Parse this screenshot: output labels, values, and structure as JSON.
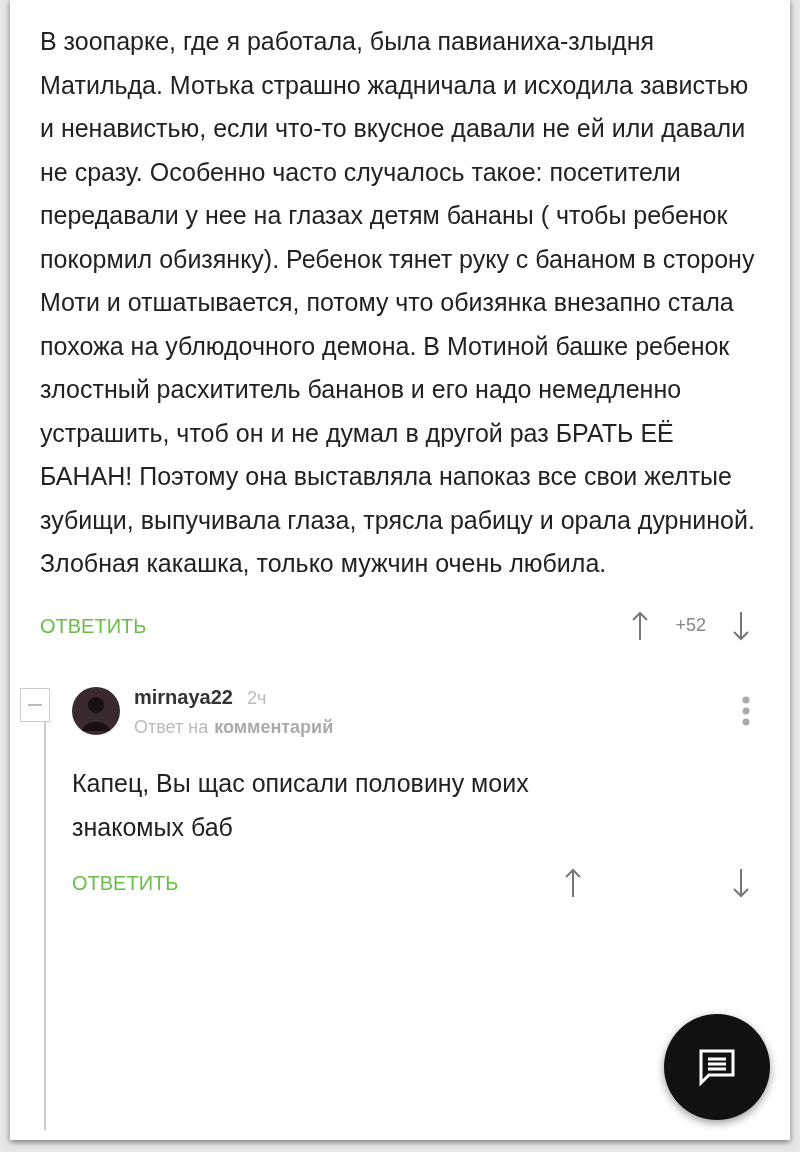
{
  "comment": {
    "text": "В зоопарке, где я работала, была павианиха-злыдня Матильда. Мотька страшно жадничала и исходила завистью и ненавистью, если что-то вкусное давали не ей или давали не сразу. Особенно часто случалось такое: посетители передавали у нее на глазах детям бананы ( чтобы ребенок покормил обизянку). Ребенок тянет руку с бананом в сторону Моти и отшатывается, потому что обизянка внезапно стала похожа на ублюдочного демона. В Мотиной башке ребенок злостный расхититель бананов и его надо немедленно устрашить, чтоб он и не думал в другой раз БРАТЬ ЕЁ БАНАН! Поэтому она выставляла напоказ все свои желтые зубищи, выпучивала глаза, трясла рабицу и орала дурниной. Злобная какашка, только мужчин очень любила.",
    "reply_label": "ОТВЕТИТЬ",
    "rating": "+52"
  },
  "reply": {
    "username": "mirnaya22",
    "time": "2ч",
    "reply_to_prefix": "Ответ на",
    "reply_to_target": "комментарий",
    "text": "Капец, Вы щас описали половину моих знакомых баб",
    "reply_label": "ОТВЕТИТЬ"
  }
}
